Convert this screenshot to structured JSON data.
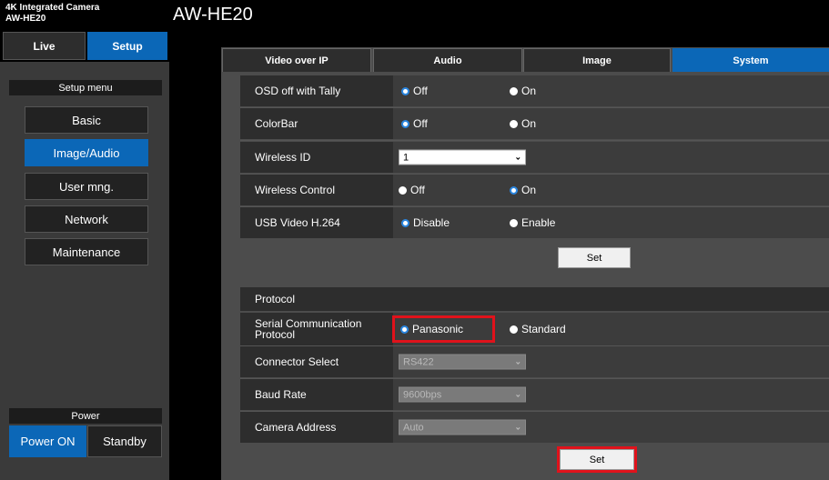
{
  "camera": {
    "line1": "4K Integrated Camera",
    "line2": "AW-HE20",
    "title": "AW-HE20"
  },
  "top_tabs": {
    "live": "Live",
    "setup": "Setup"
  },
  "sidebar": {
    "header": "Setup menu",
    "items": [
      "Basic",
      "Image/Audio",
      "User mng.",
      "Network",
      "Maintenance"
    ],
    "active_item": "Image/Audio",
    "power_header": "Power",
    "power_on": "Power ON",
    "standby": "Standby"
  },
  "main_tabs": [
    "Video over IP",
    "Audio",
    "Image",
    "System"
  ],
  "active_tab": "System",
  "system_rows": {
    "osd": {
      "label": "OSD off with Tally",
      "opt1": "Off",
      "opt2": "On",
      "selected": "Off"
    },
    "colorbar": {
      "label": "ColorBar",
      "opt1": "Off",
      "opt2": "On",
      "selected": "Off"
    },
    "wireless_id": {
      "label": "Wireless ID",
      "value": "1"
    },
    "wireless_control": {
      "label": "Wireless Control",
      "opt1": "Off",
      "opt2": "On",
      "selected": "On"
    },
    "usb_video": {
      "label": "USB Video H.264",
      "opt1": "Disable",
      "opt2": "Enable",
      "selected": "Disable"
    }
  },
  "set_label": "Set",
  "protocol": {
    "header": "Protocol",
    "serial": {
      "label_line1": "Serial Communication",
      "label_line2": "Protocol",
      "opt1": "Panasonic",
      "opt2": "Standard",
      "selected": "Panasonic"
    },
    "connector": {
      "label": "Connector Select",
      "value": "RS422"
    },
    "baud": {
      "label": "Baud Rate",
      "value": "9600bps"
    },
    "address": {
      "label": "Camera Address",
      "value": "Auto"
    }
  },
  "colors": {
    "accent": "#0b67b7",
    "highlight": "#e0121b",
    "radio_selected_ring": "#2a86e0"
  }
}
